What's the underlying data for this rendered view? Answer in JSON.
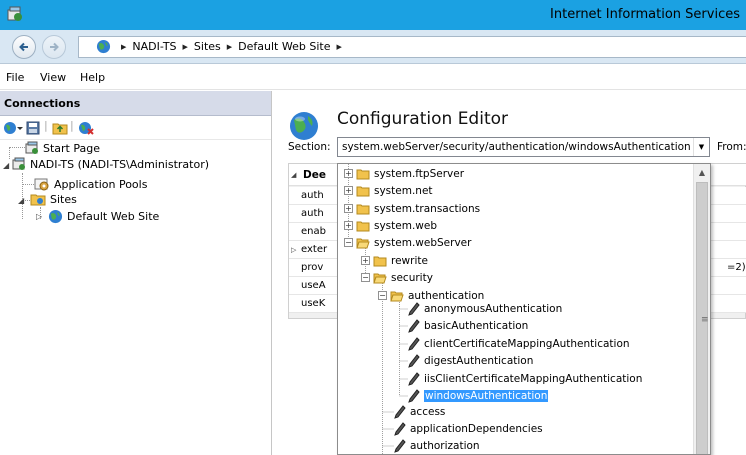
{
  "window": {
    "title": "Internet Information Services"
  },
  "address": {
    "crumbs": [
      "NADI-TS",
      "Sites",
      "Default Web Site"
    ]
  },
  "menu": {
    "items": [
      "File",
      "View",
      "Help"
    ]
  },
  "connections": {
    "header": "Connections",
    "tree": {
      "start_page": "Start Page",
      "server": "NADI-TS (NADI-TS\\Administrator)",
      "app_pools": "Application Pools",
      "sites": "Sites",
      "default_site": "Default Web Site"
    }
  },
  "editor": {
    "title": "Configuration Editor",
    "section_label": "Section:",
    "section_value": "system.webServer/security/authentication/windowsAuthentication",
    "from_label": "From:",
    "grid": {
      "header": "Dee",
      "rows": [
        "auth",
        "auth",
        "enab",
        "exter",
        "prov",
        "useA",
        "useK"
      ],
      "prov_value": "=2)"
    }
  },
  "dropdown": {
    "nodes": {
      "ftp": "system.ftpServer",
      "net": "system.net",
      "transactions": "system.transactions",
      "web": "system.web",
      "webserver": "system.webServer",
      "rewrite": "rewrite",
      "security": "security",
      "authentication": "authentication",
      "anonymous": "anonymousAuthentication",
      "basic": "basicAuthentication",
      "client_cert": "clientCertificateMappingAuthentication",
      "digest": "digestAuthentication",
      "iis_client_cert": "iisClientCertificateMappingAuthentication",
      "windows": "windowsAuthentication",
      "access": "access",
      "app_deps": "applicationDependencies",
      "authorization": "authorization"
    }
  },
  "colors": {
    "titlebar": "#1ba1e2",
    "selection": "#3399ff",
    "connections_header": "#d6dbe9"
  }
}
